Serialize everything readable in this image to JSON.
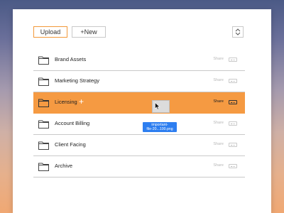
{
  "toolbar": {
    "upload_label": "Upload",
    "new_label": "+New",
    "sort_icon": "sort-updown-icon"
  },
  "files": [
    {
      "name": "Brand Assets",
      "share_label": "Share",
      "more_icon": "more-icon",
      "selected": false
    },
    {
      "name": "Marketing Strategy",
      "share_label": "Share",
      "more_icon": "more-icon",
      "selected": false
    },
    {
      "name": "Licensing",
      "share_label": "Share",
      "more_icon": "more-icon",
      "selected": true
    },
    {
      "name": "Account Billing",
      "share_label": "Share",
      "more_icon": "more-icon",
      "selected": false
    },
    {
      "name": "Client Facing",
      "share_label": "Share",
      "more_icon": "more-icon",
      "selected": false
    },
    {
      "name": "Archive",
      "share_label": "Share",
      "more_icon": "more-icon",
      "selected": false
    }
  ],
  "drag": {
    "plus_symbol": "+",
    "file_label_line1": "important-",
    "file_label_line2": "file-20...100.png"
  },
  "colors": {
    "accent": "#f59a42",
    "drag_label": "#2d7ef0",
    "divider": "#c9c9c9"
  }
}
